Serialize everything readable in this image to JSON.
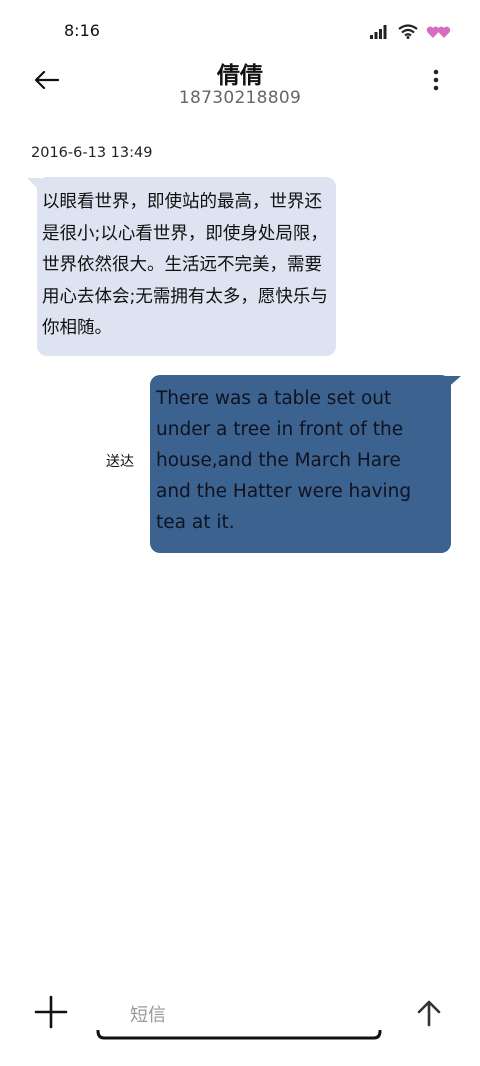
{
  "status_bar": {
    "time": "8:16",
    "icons": [
      "signal-icon",
      "wifi-icon",
      "hearts-icon"
    ],
    "hearts_color": "#d86cc0"
  },
  "header": {
    "contact_name": "倩倩",
    "contact_number": "18730218809",
    "icons": [
      "back-arrow-icon",
      "more-vert-icon"
    ]
  },
  "conversation": {
    "timestamp": "2016-6-13 13:49",
    "incoming": {
      "text": "以眼看世界，即使站的最高，世界还是很小;以心看世界，即使身处局限，世界依然很大。生活远不完美，需要用心去体会;无需拥有太多，愿快乐与你相随。",
      "bubble_color": "#dde3f0"
    },
    "outgoing": {
      "text": "There was a table set out under a tree in front of the house,and the March Hare and the Hatter were having tea at it.",
      "bubble_color": "#3c6290",
      "status": "送达"
    }
  },
  "composer": {
    "placeholder": "短信",
    "icons": [
      "plus-icon",
      "send-arrow-icon"
    ]
  }
}
